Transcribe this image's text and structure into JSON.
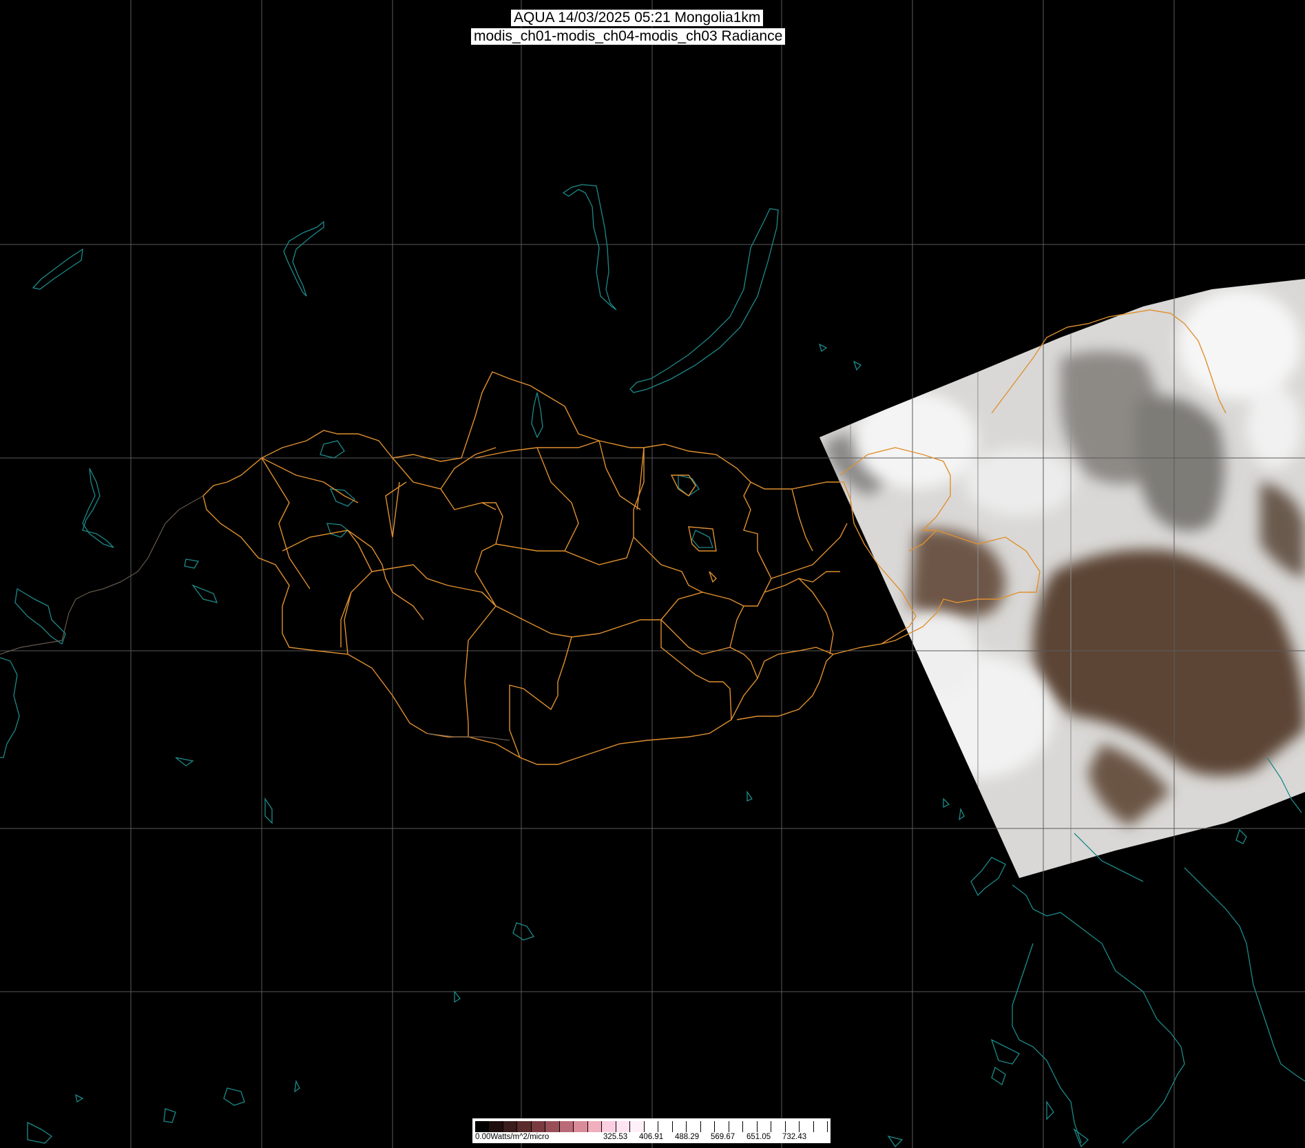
{
  "title": {
    "line1": "AQUA 14/03/2025 05:21 Mongolia1km",
    "line2": "modis_ch01-modis_ch04-modis_ch03 Radiance"
  },
  "legend": {
    "min_label": "0.00Watts/m^2/micro",
    "tick_labels": [
      "325.53",
      "406.91",
      "488.29",
      "569.67",
      "651.05",
      "732.43"
    ],
    "colors": [
      "#000000",
      "#1e0d0d",
      "#3a1c1c",
      "#5a2c2c",
      "#7a3b40",
      "#9a4f58",
      "#bb6a77",
      "#d98b99",
      "#f0aebe",
      "#fbcfe0",
      "#ffe3f0",
      "#fff0f8",
      "#ffffff",
      "#ffffff",
      "#ffffff",
      "#ffffff",
      "#ffffff",
      "#ffffff",
      "#ffffff",
      "#ffffff",
      "#ffffff",
      "#ffffff",
      "#ffffff",
      "#ffffff",
      "#ffffff"
    ]
  },
  "colors": {
    "background": "#000000",
    "grid": "#5a5a5a",
    "border": "#e0902f",
    "coast": "#1d8a8a"
  }
}
